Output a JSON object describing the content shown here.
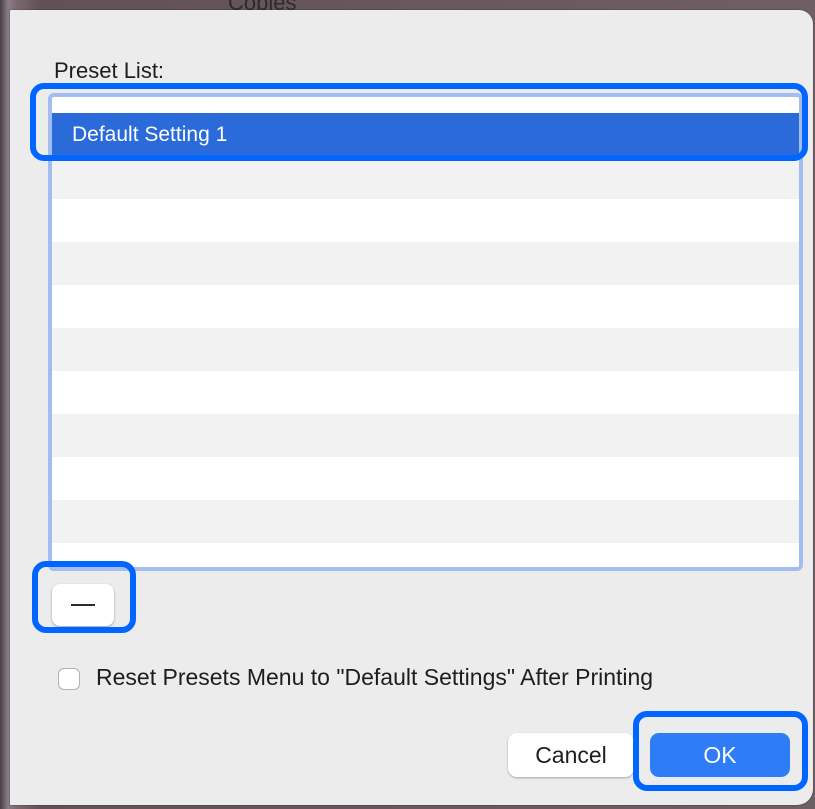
{
  "backdrop": {
    "partial_text": "Copies"
  },
  "dialog": {
    "title": "Preset List:",
    "list": {
      "items": [
        {
          "label": "Default Setting 1",
          "selected": true
        }
      ]
    },
    "remove_button_symbol": "—",
    "reset_checkbox": {
      "label": "Reset Presets Menu to \"Default Settings\" After Printing",
      "checked": false
    },
    "cancel_label": "Cancel",
    "ok_label": "OK"
  },
  "colors": {
    "selection": "#2a6ad9",
    "callout": "#0066ff",
    "primary_button": "#2e7cf6",
    "list_focus_ring": "#a3bdf0"
  }
}
